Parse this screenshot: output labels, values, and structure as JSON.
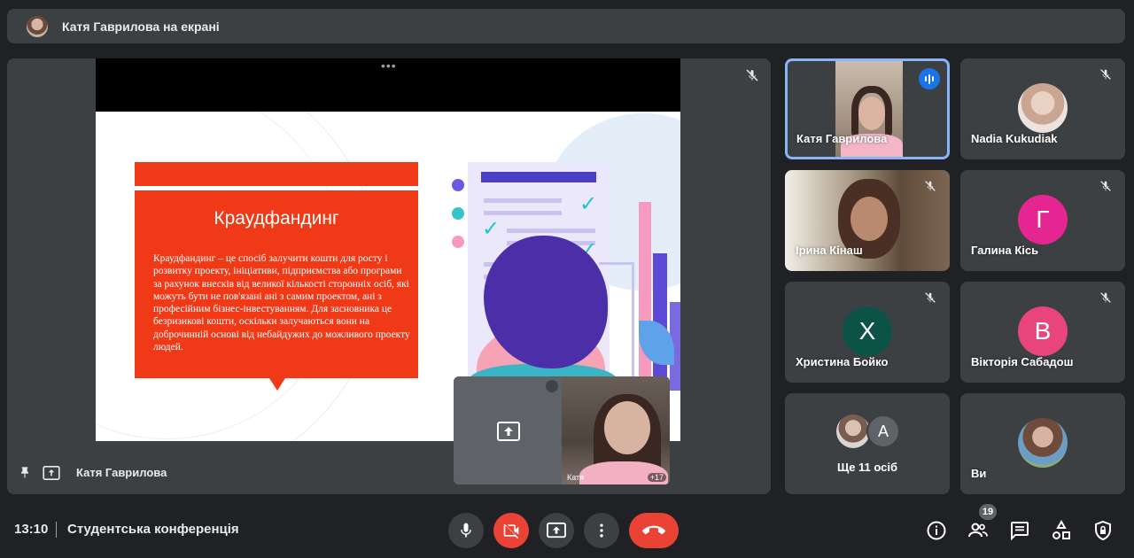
{
  "banner": {
    "text": "Катя Гаврилова на екрані"
  },
  "stage": {
    "presenter_name": "Катя Гаврилова",
    "slide": {
      "title": "Краудфандинг",
      "body": "Краудфандинг – це спосіб залучити кошти для росту і розвитку проекту, ініціативи, підприємства або програми за рахунок внесків від великої кількості сторонніх осіб, які можуть бути не пов'язані ані з самим проектом, ані з професійним бізнес-інвестуванням. Для засновника це безризикові кошти, оскільки залучаються вони на доброчинній основі від небайдужих до можливого проекту людей."
    },
    "self_view": {
      "label": "Катя",
      "count": "+17"
    }
  },
  "tiles": [
    {
      "name": "Катя Гаврилова",
      "speaking": true
    },
    {
      "name": "Nadia Kukudiak"
    },
    {
      "name": "Ірина Кінаш"
    },
    {
      "name": "Галина Кісь",
      "initial": "Г",
      "color": "#e52592"
    },
    {
      "name": "Христина Бойко",
      "initial": "Х",
      "color": "#0b5346"
    },
    {
      "name": "Вікторія Сабадош",
      "initial": "В",
      "color": "#e8457c"
    },
    {
      "name": "Ще 11 осіб",
      "initial": "A",
      "color": "#5f6368"
    },
    {
      "name": "Ви"
    }
  ],
  "bottom": {
    "time": "13:10",
    "meeting_name": "Студентська конференція",
    "participants_count": "19"
  },
  "icons": {
    "mic": "microphone-icon",
    "camera_off": "camera-off-icon",
    "present": "present-screen-icon",
    "more": "more-vert-icon",
    "end_call": "end-call-icon",
    "info": "info-icon",
    "people": "people-icon",
    "chat": "chat-icon",
    "activities": "activities-icon",
    "host": "host-controls-icon"
  },
  "colors": {
    "accent_blue": "#1a73e8",
    "danger_red": "#ea4335",
    "slide_red": "#f03a17"
  }
}
